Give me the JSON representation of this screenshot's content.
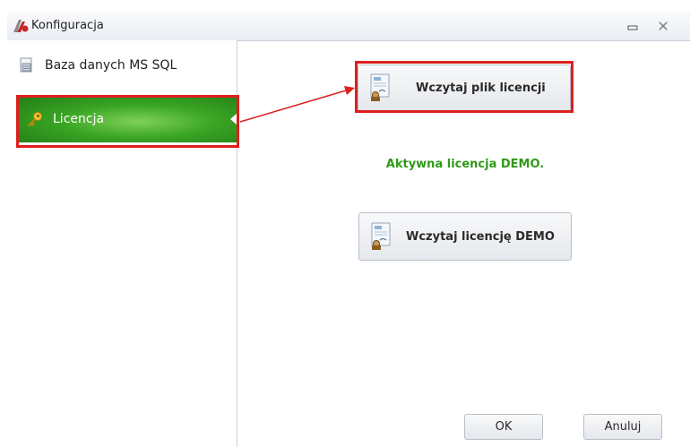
{
  "window": {
    "title": "Konfiguracja"
  },
  "sidebar": {
    "items": [
      {
        "label": "Baza danych MS SQL",
        "icon": "database-file-icon"
      },
      {
        "label": "Licencja",
        "icon": "key-icon",
        "selected": true
      }
    ]
  },
  "main": {
    "load_license_label": "Wczytaj plik licencji",
    "status_text": "Aktywna licencja DEMO.",
    "load_demo_label": "Wczytaj licencję DEMO"
  },
  "footer": {
    "ok_label": "OK",
    "cancel_label": "Anuluj"
  },
  "colors": {
    "accent_green": "#3aa524",
    "status_green": "#2f9a18",
    "highlight_red": "#dd1f1f"
  }
}
